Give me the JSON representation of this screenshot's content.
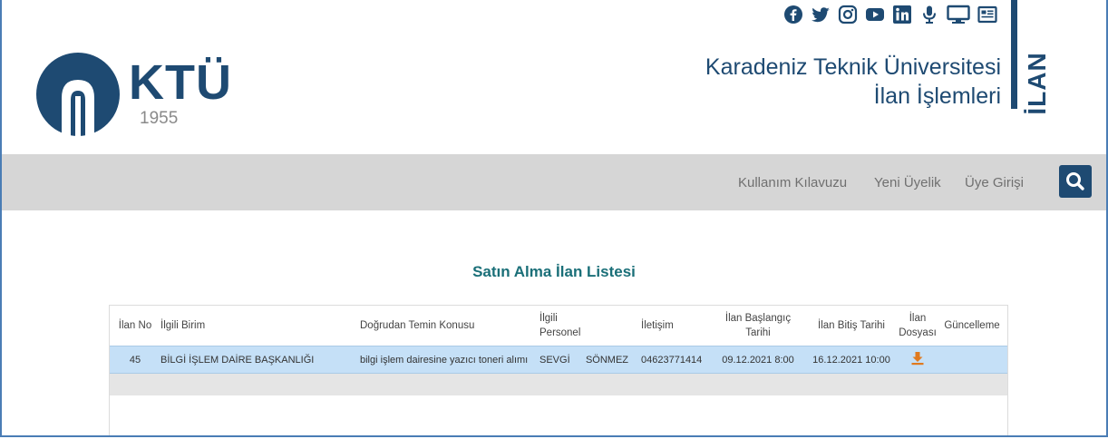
{
  "header": {
    "logo_text": "KTÜ",
    "logo_year": "1955",
    "university_name": "Karadeniz Teknik Üniversitesi",
    "subtitle": "İlan İşlemleri",
    "vertical_label": "İLAN",
    "social_icons": [
      "facebook-icon",
      "twitter-icon",
      "instagram-icon",
      "youtube-icon",
      "linkedin-icon",
      "microphone-icon",
      "monitor-icon",
      "news-icon"
    ],
    "brand_color": "#1e4a72"
  },
  "nav": {
    "items": [
      {
        "label": "Kullanım Kılavuzu"
      },
      {
        "label": "Yeni Üyelik"
      },
      {
        "label": "Üye Girişi"
      }
    ],
    "search_icon": "search-icon"
  },
  "main": {
    "title": "Satın Alma İlan Listesi",
    "table": {
      "columns": {
        "ilan_no": "İlan No",
        "birim": "İlgili Birim",
        "konu": "Doğrudan Temin Konusu",
        "personel_1": "İlgili",
        "personel_2": "Personel",
        "iletisim": "İletişim",
        "baslangic_1": "İlan Başlangıç",
        "baslangic_2": "Tarihi",
        "bitis": "İlan Bitiş Tarihi",
        "dosya_1": "İlan",
        "dosya_2": "Dosyası",
        "guncelleme": "Güncelleme"
      },
      "rows": [
        {
          "ilan_no": "45",
          "birim": "BİLGİ İŞLEM DAİRE BAŞKANLIĞI",
          "konu": "bilgi işlem dairesine yazıcı toneri alımı",
          "personel_ad": "SEVGİ",
          "personel_soyad": "SÖNMEZ",
          "iletisim": "04623771414",
          "baslangic": "09.12.2021 8:00",
          "bitis": "16.12.2021 10:00",
          "dosya_icon": "download-icon"
        }
      ]
    }
  }
}
